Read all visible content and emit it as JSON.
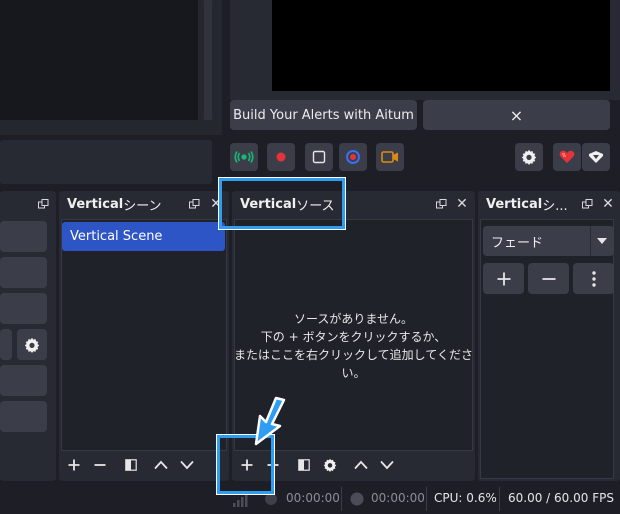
{
  "alerts": {
    "build_label": "Build Your Alerts with Aitum",
    "close_label": "×"
  },
  "scenes_dock": {
    "title_bold": "Vertical",
    "title_suffix": " シーン",
    "items": [
      "Vertical Scene"
    ]
  },
  "sources_dock": {
    "title_bold": "Vertical",
    "title_suffix": " ソース",
    "empty_line1": "ソースがありません。",
    "empty_line2": "下の + ボタンをクリックするか、",
    "empty_line3": "またはここを右クリックして追加してください。"
  },
  "transitions_dock": {
    "title_bold": "Vertical",
    "title_suffix": " シ...",
    "transition_value": "フェード",
    "add_label": "+",
    "remove_label": "−",
    "more_label": "⋮"
  },
  "status": {
    "stream_time": "00:00:00",
    "record_time": "00:00:00",
    "cpu": "CPU: 0.6%",
    "fps": "60.00 / 60.00 FPS"
  },
  "colors": {
    "accent_blue": "#2f9df2",
    "selected_scene": "#2e55c6",
    "stream_green": "#19b878",
    "record_red": "#e6333a",
    "vcam_orange": "#e08a16"
  },
  "icons": [
    "stream-icon",
    "record-icon",
    "studio-mode-icon",
    "virtual-camera-icon",
    "replay-icon",
    "gear-icon",
    "heart-icon",
    "aitum-icon",
    "undock-icon",
    "close-icon",
    "plus-icon",
    "minus-icon",
    "filter-icon",
    "up-arrow-icon",
    "down-arrow-icon",
    "arrow-pointer-icon",
    "signal-bars-icon"
  ]
}
